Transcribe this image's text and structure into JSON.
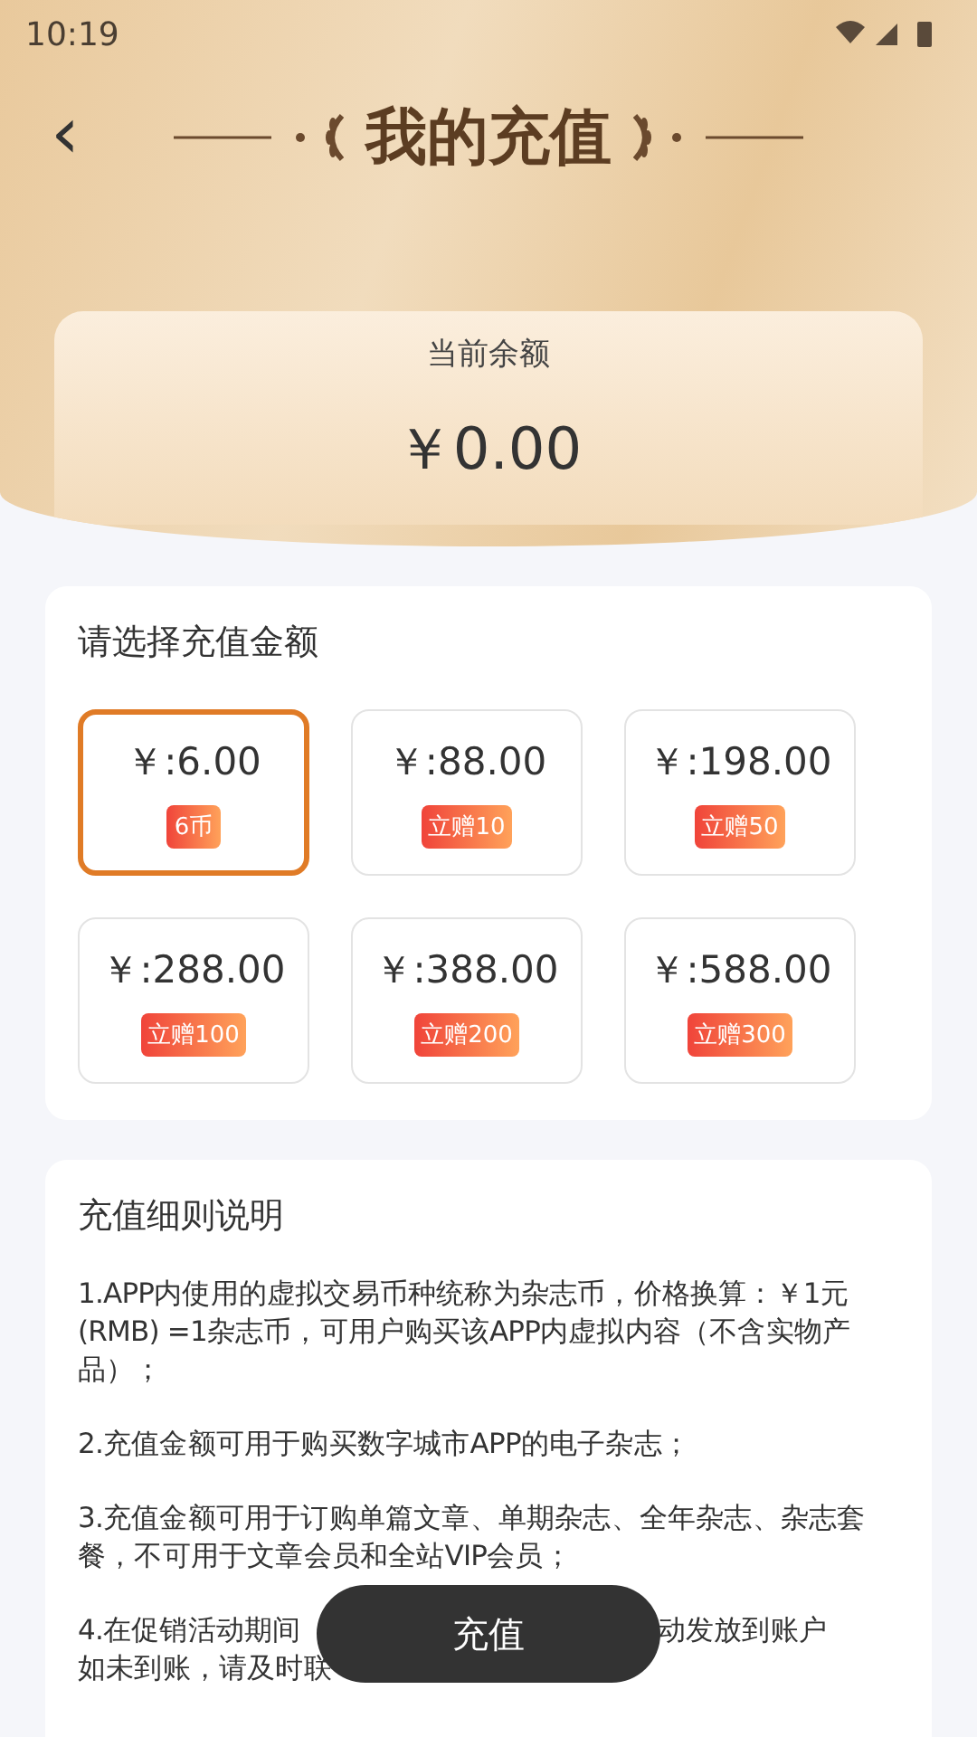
{
  "status_bar": {
    "time": "10:19"
  },
  "header": {
    "back": "‹",
    "title": "我的充值"
  },
  "balance": {
    "label": "当前余额",
    "amount": "￥0.00"
  },
  "amounts": {
    "title": "请选择充值金额",
    "options": [
      {
        "price": "￥:6.00",
        "bonus": "6币",
        "selected": true
      },
      {
        "price": "￥:88.00",
        "bonus": "立赠10",
        "selected": false
      },
      {
        "price": "￥:198.00",
        "bonus": "立赠50",
        "selected": false
      },
      {
        "price": "￥:288.00",
        "bonus": "立赠100",
        "selected": false
      },
      {
        "price": "￥:388.00",
        "bonus": "立赠200",
        "selected": false
      },
      {
        "price": "￥:588.00",
        "bonus": "立赠300",
        "selected": false
      }
    ]
  },
  "rules": {
    "title": "充值细则说明",
    "items": [
      {
        "kind": "text",
        "text": "1.APP内使用的虚拟交易币种统称为杂志币，价格换算：￥1元 (RMB) =1杂志币，可用户购买该APP内虚拟内容（不含实物产品）；"
      },
      {
        "kind": "text",
        "text": "2.充值金额可用于购买数字城市APP的电子杂志；"
      },
      {
        "kind": "text",
        "text": "3.充值金额可用于订购单篇文章、单期杂志、全年杂志、杂志套餐，不可用于文章会员和全站VIP会员；"
      },
      {
        "kind": "covered",
        "fragments": [
          "4.在促销活动期间",
          "动发放到账户",
          "如未到账，请及时联"
        ]
      }
    ]
  },
  "recharge_button": "充值"
}
